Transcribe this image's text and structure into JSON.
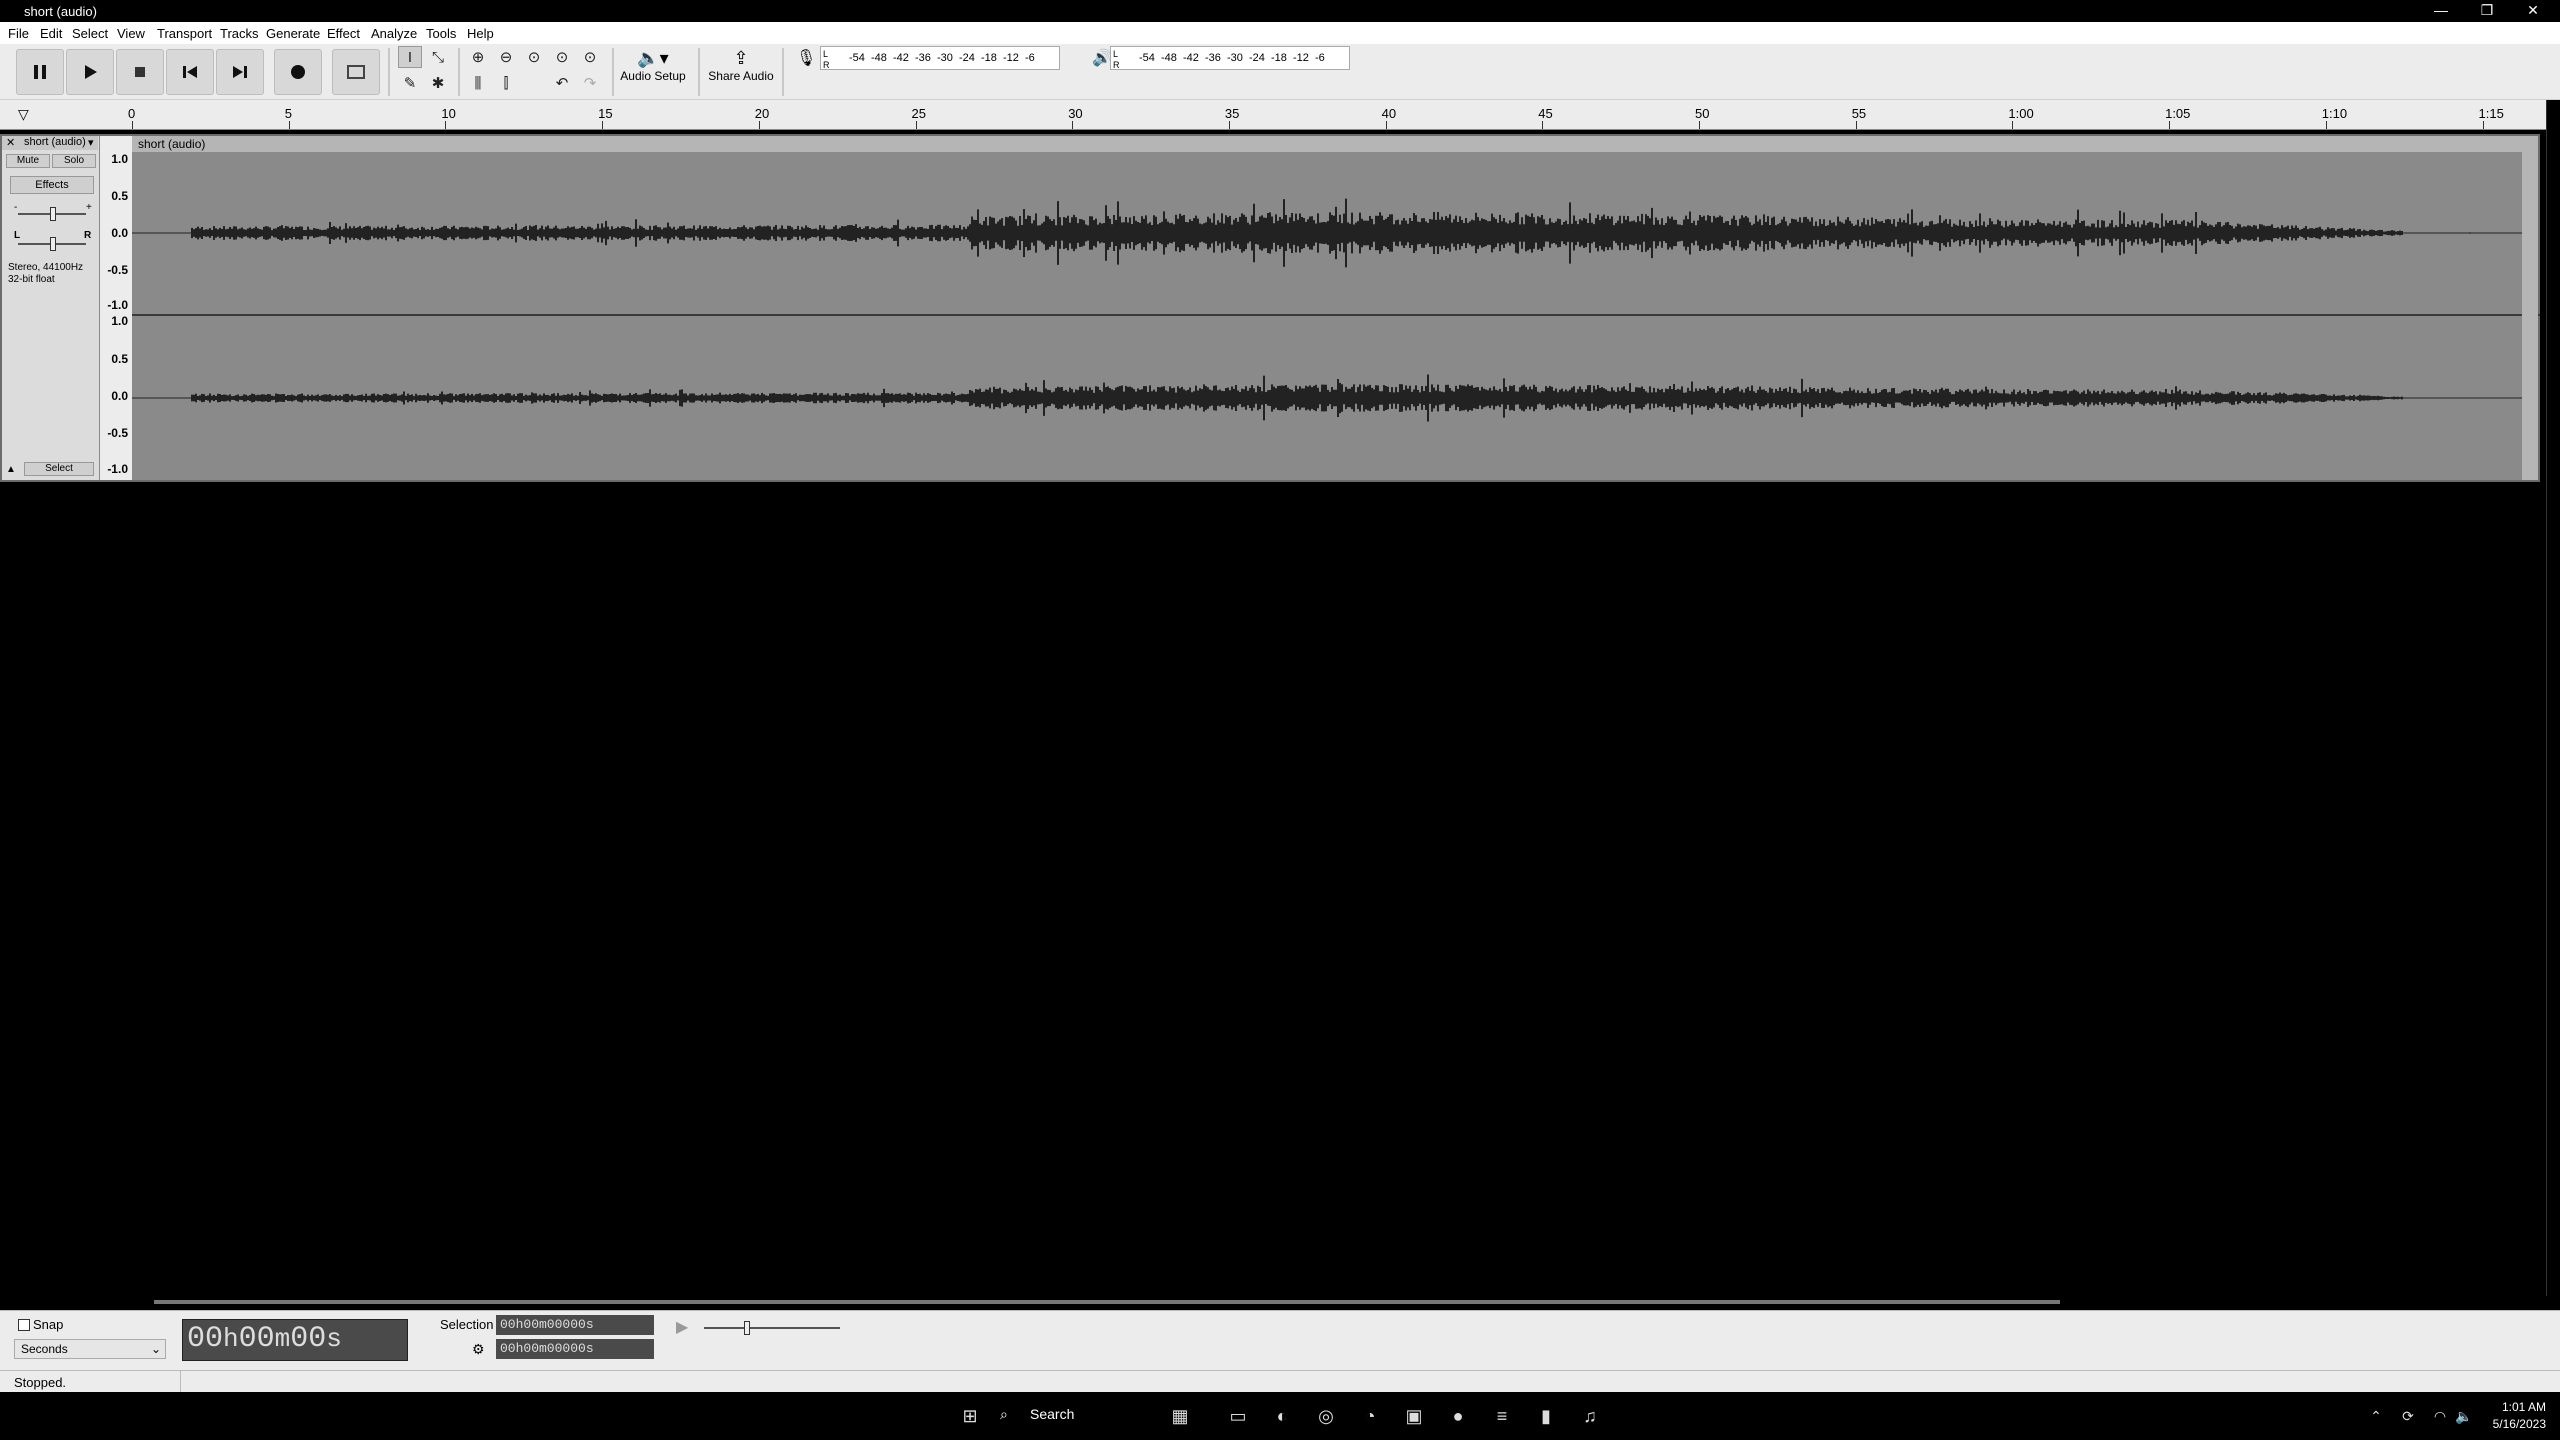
{
  "window": {
    "title": "short (audio)"
  },
  "menu": [
    "File",
    "Edit",
    "Select",
    "View",
    "Transport",
    "Tracks",
    "Generate",
    "Effect",
    "Analyze",
    "Tools",
    "Help"
  ],
  "toolbar": {
    "audio_setup": "Audio Setup",
    "share_audio": "Share Audio",
    "meter_ticks": [
      "-54",
      "-48",
      "-42",
      "-36",
      "-30",
      "-24",
      "-18",
      "-12",
      "-6"
    ],
    "meter_rec_lr": [
      "L",
      "R"
    ],
    "meter_play_lr": [
      "L",
      "R"
    ]
  },
  "ruler": {
    "ticks": [
      "0",
      "5",
      "10",
      "15",
      "20",
      "25",
      "30",
      "35",
      "40",
      "45",
      "50",
      "55",
      "1:00",
      "1:05",
      "1:10",
      "1:15"
    ]
  },
  "track": {
    "name": "short (audio)",
    "clip_name": "short (audio)",
    "mute": "Mute",
    "solo": "Solo",
    "effects": "Effects",
    "gain_minus": "-",
    "gain_plus": "+",
    "pan_left": "L",
    "pan_right": "R",
    "info_line1": "Stereo, 44100Hz",
    "info_line2": "32-bit float",
    "select": "Select",
    "scale_top": [
      "1.0",
      "0.5",
      "0.0",
      "-0.5",
      "-1.0"
    ],
    "scale_bottom": [
      "1.0",
      "0.5",
      "0.0",
      "-0.5",
      "-1.0"
    ]
  },
  "selection_bar": {
    "snap_label": "Snap",
    "snap_checked": false,
    "snap_unit": "Seconds",
    "time_display": [
      "00",
      "h",
      "00",
      "m",
      "00",
      "s"
    ],
    "selection_label": "Selection",
    "sel_start": "00h00m00000s",
    "sel_end": "00h00m00000s"
  },
  "status": {
    "text": "Stopped."
  },
  "taskbar": {
    "search": "Search",
    "time": "1:01 AM",
    "date": "5/16/2023"
  },
  "colors": {
    "waveform": "#000000",
    "clip_bg": "#8a8a8a",
    "toolbar": "#ececec"
  }
}
